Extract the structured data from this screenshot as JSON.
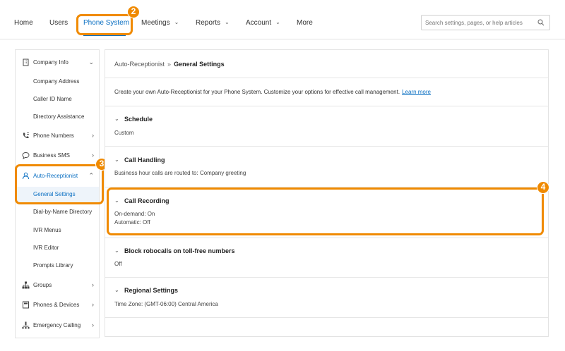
{
  "nav": {
    "home": "Home",
    "users": "Users",
    "phone_system": "Phone System",
    "meetings": "Meetings",
    "reports": "Reports",
    "account": "Account",
    "more": "More",
    "search_placeholder": "Search settings, pages, or help articles",
    "chevron": "⌄"
  },
  "badges": {
    "b2": "2",
    "b3": "3",
    "b4": "4"
  },
  "colors": {
    "accent": "#0a6fc2",
    "callout": "#f08a00"
  },
  "sidebar": {
    "company_info": "Company Info",
    "company_address": "Company Address",
    "caller_id_name": "Caller ID Name",
    "directory_assistance": "Directory Assistance",
    "phone_numbers": "Phone Numbers",
    "business_sms": "Business SMS",
    "auto_receptionist": "Auto-Receptionist",
    "general_settings": "General Settings",
    "dial_by_name": "Dial-by-Name Directory",
    "ivr_menus": "IVR Menus",
    "ivr_editor": "IVR Editor",
    "prompts_library": "Prompts Library",
    "groups": "Groups",
    "phones_devices": "Phones & Devices",
    "emergency_calling": "Emergency Calling",
    "chev_down": "⌄",
    "chev_up": "⌃",
    "chev_right": "›"
  },
  "main": {
    "breadcrumb_parent": "Auto-Receptionist",
    "breadcrumb_sep": "»",
    "breadcrumb_current": "General Settings",
    "intro_text": "Create your own Auto-Receptionist for your Phone System. Customize your options for effective call management.",
    "learn_more": "Learn more",
    "chevron": "⌄",
    "schedule_title": "Schedule",
    "schedule_value": "Custom",
    "call_handling_title": "Call Handling",
    "call_handling_value": "Business hour calls are routed to: Company greeting",
    "call_recording_title": "Call Recording",
    "call_recording_ondemand": "On-demand: On",
    "call_recording_auto": "Automatic: Off",
    "robocalls_title": "Block robocalls on toll-free numbers",
    "robocalls_value": "Off",
    "regional_title": "Regional Settings",
    "regional_value": "Time Zone: (GMT-06:00) Central America"
  }
}
